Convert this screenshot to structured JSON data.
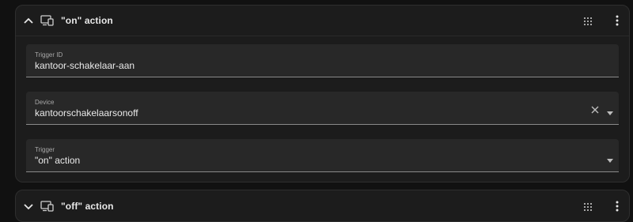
{
  "cards": [
    {
      "title": "\"on\" action",
      "expanded": true,
      "fields": {
        "trigger_id": {
          "label": "Trigger ID",
          "value": "kantoor-schakelaar-aan"
        },
        "device": {
          "label": "Device",
          "value": "kantoorschakelaarsonoff"
        },
        "trigger": {
          "label": "Trigger",
          "value": "\"on\" action"
        }
      }
    },
    {
      "title": "\"off\" action",
      "expanded": false
    }
  ],
  "icons": {
    "chevron_up": "chevron-up-icon",
    "chevron_down": "chevron-down-icon",
    "device": "device-icon",
    "drag": "drag-handle-icon",
    "more": "more-vert-icon",
    "clear": "close-icon",
    "dropdown": "dropdown-arrow-icon"
  },
  "colors": {
    "background": "#111111",
    "card": "#1c1c1c",
    "field": "#282828",
    "text": "#e1e1e1",
    "label": "#a8a8a8"
  }
}
